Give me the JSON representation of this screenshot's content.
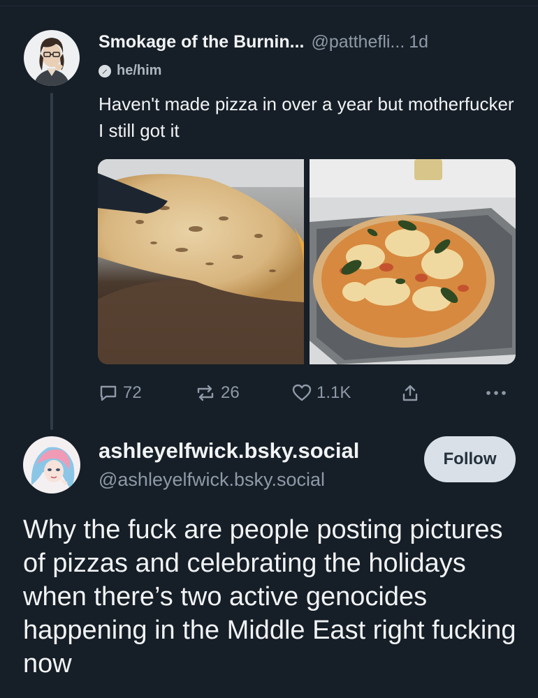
{
  "post1": {
    "display_name": "Smokage of the Burnin...",
    "handle": "@patthefli...",
    "separator": " ",
    "time_ago": "1d",
    "pronouns": "he/him",
    "text": "Haven't made pizza in over a year but motherfucker I still got it",
    "images": [
      "pizza-crust-underside-photo",
      "margherita-pizza-photo"
    ],
    "actions": {
      "reply_count": "72",
      "repost_count": "26",
      "like_count": "1.1K"
    }
  },
  "post2": {
    "display_name": "ashleyelfwick.bsky.social",
    "handle": "@ashleyelfwick.bsky.social",
    "follow_label": "Follow",
    "text": "Why the fuck are people posting pictures of pizzas and celebrating the holidays when there’s two active genocides happening in the Middle East right fucking now"
  },
  "colors": {
    "background": "#161e27",
    "text": "#f1f3f5",
    "muted": "#8e9aa8",
    "thread_line": "#2f3c4a",
    "follow_bg": "#d9e0e7"
  }
}
